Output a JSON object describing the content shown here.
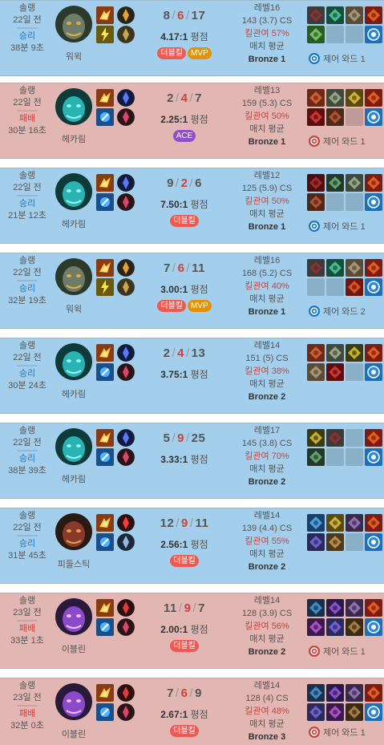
{
  "labels": {
    "kda_sep": "/",
    "ratio_suffix": "평점",
    "avg_suffix": "매치 평균",
    "ward_prefix": "제어 와드"
  },
  "colors": {
    "win_bg": "#a3cfec",
    "loss_bg": "#e2b6b3",
    "win_text": "#1a78c2",
    "loss_text": "#c6443e",
    "multikill_badge": "#ee5a52",
    "mvp_badge": "#e19205",
    "ace_badge": "#8c51c5"
  },
  "matches": [
    {
      "outcome": "win",
      "queue": "솔랭",
      "ago": "22일 전",
      "result": "승리",
      "duration": "38분 9초",
      "champion": "워윅",
      "champion_icon": "warwick-icon",
      "spells": [
        "ghost-spell-icon",
        "flash-spell-icon"
      ],
      "runes": [
        "conqueror-rune-icon",
        "precision-rune-icon"
      ],
      "kda": {
        "k": "8",
        "d": "6",
        "a": "17"
      },
      "ratio": "4.17:1",
      "badges": [
        {
          "text": "더블킬",
          "kind": "multi"
        },
        {
          "text": "MVP",
          "kind": "mvp"
        }
      ],
      "level": "레벨16",
      "cs": "143 (3.7) CS",
      "kp": "킬관여 57%",
      "avg": "매치 평균",
      "tier": "Bronze 1",
      "items": [
        "black-cleaver-icon",
        "blade-of-ruined-king-icon",
        "plated-steelcaps-icon",
        "sunfire-icon",
        "warmogs-icon",
        "empty",
        "empty",
        "oracle-lens-icon"
      ],
      "ward": "제어 와드 1"
    },
    {
      "outcome": "loss",
      "queue": "솔랭",
      "ago": "22일 전",
      "result": "패배",
      "duration": "30분 16초",
      "champion": "헤카림",
      "champion_icon": "hecarim-icon",
      "spells": [
        "ghost-spell-icon",
        "smite-spell-icon"
      ],
      "runes": [
        "phase-rush-rune-icon",
        "domination-rune-icon"
      ],
      "kda": {
        "k": "2",
        "d": "4",
        "a": "7"
      },
      "ratio": "2.25:1",
      "badges": [
        {
          "text": "ACE",
          "kind": "ace"
        }
      ],
      "level": "레벨13",
      "cs": "159 (5.3) CS",
      "kp": "킬관여 50%",
      "avg": "매치 평균",
      "tier": "Bronze 1",
      "items": [
        "ravenous-hydra-icon",
        "mercury-treads-icon",
        "trinity-force-icon",
        "sunfire-icon",
        "ruby-crystal-icon",
        "phage-icon",
        "empty",
        "oracle-lens-icon"
      ],
      "ward": "제어 와드 1"
    },
    {
      "outcome": "win",
      "queue": "솔랭",
      "ago": "22일 전",
      "result": "승리",
      "duration": "21분 12초",
      "champion": "헤카림",
      "champion_icon": "hecarim-icon",
      "spells": [
        "ghost-spell-icon",
        "smite-spell-icon"
      ],
      "runes": [
        "phase-rush-rune-icon",
        "domination-rune-icon"
      ],
      "kda": {
        "k": "9",
        "d": "2",
        "a": "6"
      },
      "ratio": "7.50:1",
      "badges": [
        {
          "text": "더블킬",
          "kind": "multi"
        }
      ],
      "level": "레벨12",
      "cs": "125 (5.9) CS",
      "kp": "킬관여 50%",
      "avg": "매치 평균",
      "tier": "Bronze 1",
      "items": [
        "sanguine-blade-icon",
        "youmuus-icon",
        "mercury-treads-icon",
        "sunfire-icon",
        "phage-icon",
        "empty",
        "empty",
        "oracle-lens-icon"
      ],
      "ward": "제어 와드 1"
    },
    {
      "outcome": "win",
      "queue": "솔랭",
      "ago": "22일 전",
      "result": "승리",
      "duration": "32분 19초",
      "champion": "워윅",
      "champion_icon": "warwick-icon",
      "spells": [
        "ghost-spell-icon",
        "flash-spell-icon"
      ],
      "runes": [
        "conqueror-rune-icon",
        "precision-rune-icon"
      ],
      "kda": {
        "k": "7",
        "d": "6",
        "a": "11"
      },
      "ratio": "3.00:1",
      "badges": [
        {
          "text": "더블킬",
          "kind": "multi"
        },
        {
          "text": "MVP",
          "kind": "mvp"
        }
      ],
      "level": "레벨16",
      "cs": "168 (5.2) CS",
      "kp": "킬관여 40%",
      "avg": "매치 평균",
      "tier": "Bronze 1",
      "items": [
        "black-cleaver-icon",
        "blade-of-ruined-king-icon",
        "plated-steelcaps-icon",
        "sunfire-icon",
        "empty",
        "empty",
        "sunfire-cape-icon",
        "oracle-lens-icon"
      ],
      "ward": "제어 와드 2"
    },
    {
      "outcome": "win",
      "queue": "솔랭",
      "ago": "22일 전",
      "result": "승리",
      "duration": "30분 24초",
      "champion": "헤카림",
      "champion_icon": "hecarim-icon",
      "spells": [
        "ghost-spell-icon",
        "smite-spell-icon"
      ],
      "runes": [
        "phase-rush-rune-icon",
        "domination-rune-icon"
      ],
      "kda": {
        "k": "2",
        "d": "4",
        "a": "13"
      },
      "ratio": "3.75:1",
      "badges": [],
      "level": "레벨14",
      "cs": "151 (5) CS",
      "kp": "킬관여 38%",
      "avg": "매치 평균",
      "tier": "Bronze 2",
      "items": [
        "ravenous-hydra-icon",
        "mercury-treads-icon",
        "zekes-icon",
        "sunfire-icon",
        "plated-steelcaps-icon",
        "ruby-crystal-icon",
        "empty",
        "oracle-lens-icon"
      ],
      "ward": ""
    },
    {
      "outcome": "win",
      "queue": "솔랭",
      "ago": "22일 전",
      "result": "승리",
      "duration": "38분 39초",
      "champion": "헤카림",
      "champion_icon": "hecarim-icon",
      "spells": [
        "ghost-spell-icon",
        "smite-spell-icon"
      ],
      "runes": [
        "phase-rush-rune-icon",
        "domination-rune-icon"
      ],
      "kda": {
        "k": "5",
        "d": "9",
        "a": "25"
      },
      "ratio": "3.33:1",
      "badges": [],
      "level": "레벨17",
      "cs": "145 (3.8) CS",
      "kp": "킬관여 70%",
      "avg": "매치 평균",
      "tier": "Bronze 2",
      "items": [
        "zekes-icon",
        "black-cleaver-icon",
        "empty",
        "sunfire-icon",
        "youmuus-icon",
        "empty",
        "empty",
        "oracle-lens-icon"
      ],
      "ward": ""
    },
    {
      "outcome": "win",
      "queue": "솔랭",
      "ago": "22일 전",
      "result": "승리",
      "duration": "31분 45초",
      "champion": "피들스틱",
      "champion_icon": "fiddlesticks-icon",
      "spells": [
        "ghost-spell-icon",
        "smite-spell-icon"
      ],
      "runes": [
        "dark-harvest-rune-icon",
        "sorcery-rune-icon"
      ],
      "kda": {
        "k": "12",
        "d": "9",
        "a": "11"
      },
      "ratio": "2.56:1",
      "badges": [
        {
          "text": "더블킬",
          "kind": "multi"
        }
      ],
      "level": "레벨14",
      "cs": "139 (4.4) CS",
      "kp": "킬관여 55%",
      "avg": "매치 평균",
      "tier": "Bronze 2",
      "items": [
        "ludens-icon",
        "zhonyas-icon",
        "sorcerer-shoes-icon",
        "sunfire-icon",
        "rabadons-icon",
        "blasting-wand-icon",
        "empty",
        "oracle-lens-icon"
      ],
      "ward": ""
    },
    {
      "outcome": "loss",
      "queue": "솔랭",
      "ago": "23일 전",
      "result": "패배",
      "duration": "33분 1초",
      "champion": "이블린",
      "champion_icon": "evelynn-icon",
      "spells": [
        "ghost-spell-icon",
        "smite-spell-icon"
      ],
      "runes": [
        "electrocute-rune-icon",
        "domination-rune-icon"
      ],
      "kda": {
        "k": "11",
        "d": "9",
        "a": "7"
      },
      "ratio": "2.00:1",
      "badges": [
        {
          "text": "더블킬",
          "kind": "multi"
        }
      ],
      "level": "레벨14",
      "cs": "128 (3.9) CS",
      "kp": "킬관여 56%",
      "avg": "매치 평균",
      "tier": "Bronze 2",
      "items": [
        "nightharvester-icon",
        "lichbane-icon",
        "sorcerer-shoes-icon",
        "sunfire-icon",
        "void-staff-icon",
        "rabadons-icon",
        "needlessly-rod-icon",
        "oracle-lens-icon"
      ],
      "ward": "제어 와드 1"
    },
    {
      "outcome": "loss",
      "queue": "솔랭",
      "ago": "23일 전",
      "result": "패배",
      "duration": "32분 0초",
      "champion": "이블린",
      "champion_icon": "evelynn-icon",
      "spells": [
        "ghost-spell-icon",
        "smite-spell-icon"
      ],
      "runes": [
        "electrocute-rune-icon",
        "domination-rune-icon"
      ],
      "kda": {
        "k": "7",
        "d": "6",
        "a": "9"
      },
      "ratio": "2.67:1",
      "badges": [
        {
          "text": "더블킬",
          "kind": "multi"
        }
      ],
      "level": "레벨14",
      "cs": "128 (4) CS",
      "kp": "킬관여 48%",
      "avg": "매치 평균",
      "tier": "Bronze 3",
      "items": [
        "nightharvester-icon",
        "lichbane-icon",
        "sorcerer-shoes-icon",
        "sunfire-icon",
        "rabadons-icon",
        "void-staff-icon",
        "needlessly-rod-icon",
        "oracle-lens-icon"
      ],
      "ward": "제어 와드 1"
    }
  ]
}
